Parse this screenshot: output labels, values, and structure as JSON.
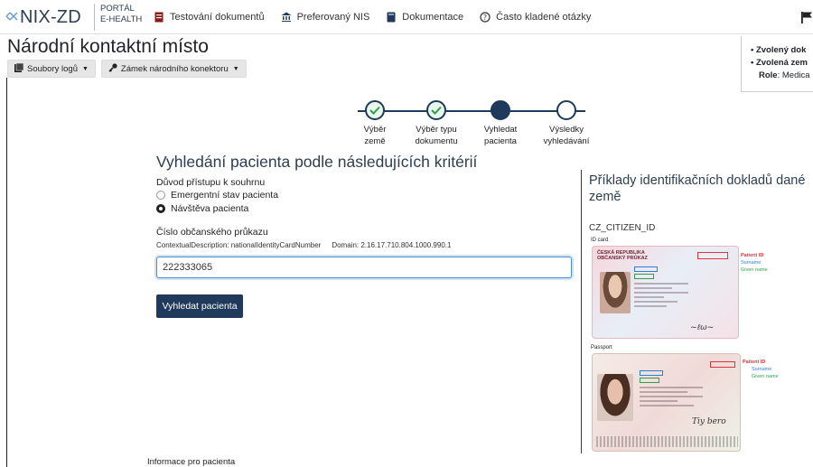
{
  "nav": {
    "logo": "NIX-ZD",
    "portal_line1": "PORTÁL",
    "portal_line2": "E-HEALTH",
    "links": [
      {
        "label": "Testování dokumentů",
        "icon": "document-icon"
      },
      {
        "label": "Preferovaný NIS",
        "icon": "building-icon"
      },
      {
        "label": "Dokumentace",
        "icon": "book-icon"
      },
      {
        "label": "Často kladené otázky",
        "icon": "question-circle-icon"
      }
    ]
  },
  "header": {
    "title": "Národní kontaktní místo",
    "log_files_button": "Soubory logů",
    "lock_button": "Zámek národního konektoru"
  },
  "right_info": {
    "item1": "Zvolený dok",
    "item2": "Zvolená zem",
    "role_label": "Role",
    "role_value": ": Medica"
  },
  "stepper": {
    "steps": [
      {
        "line1": "Výběr",
        "line2": "země",
        "state": "done"
      },
      {
        "line1": "Výběr typu",
        "line2": "dokumentu",
        "state": "done"
      },
      {
        "line1": "Vyhledat",
        "line2": "pacienta",
        "state": "active"
      },
      {
        "line1": "Výsledky",
        "line2": "vyhledávání",
        "state": "pending"
      }
    ]
  },
  "form": {
    "title": "Vyhledání pacienta podle následujících kritérií",
    "reason_label": "Důvod přístupu k souhrnu",
    "options": [
      {
        "label": "Emergentní stav pacienta",
        "checked": false
      },
      {
        "label": "Návštěva pacienta",
        "checked": true
      }
    ],
    "id_label": "Číslo občanského průkazu",
    "contextual_description": "ContextualDescription: nationalIdentityCardNumber",
    "domain": "Domain: 2.16.17.710.804.1000.990.1",
    "id_value": "222333065",
    "search_button": "Vyhledat pacienta",
    "info_link": "Informace pro pacienta"
  },
  "examples": {
    "title": "Příklady identifikačních dokladů dané země",
    "doc_type": "CZ_CITIZEN_ID",
    "id_card_caption": "ID card",
    "passport_caption": "Passport",
    "card_header_1": "ČESKÁ REPUBLIKA",
    "card_header_2": "OBČANSKÝ PRŮKAZ",
    "annotations": {
      "patient_id": "Patient ID",
      "surname": "Surname",
      "given_name": "Given name"
    },
    "colors": {
      "patient_id": "#d9363e",
      "surname": "#2f7dd1",
      "given_name": "#2e9e4f"
    }
  },
  "colors": {
    "primary": "#1f3a5a",
    "title": "#2c3e50"
  }
}
